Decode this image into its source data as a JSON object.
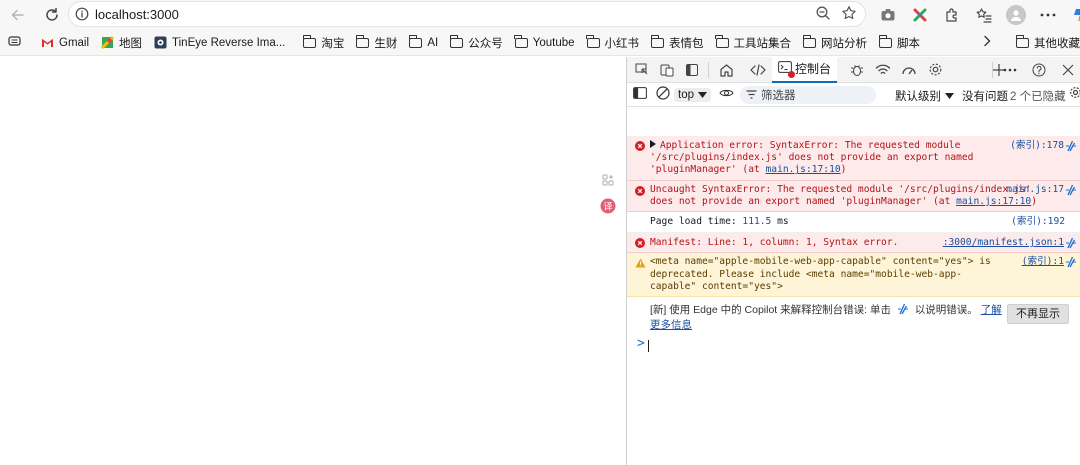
{
  "toolbar": {
    "url": "localhost:3000"
  },
  "bookmarks": {
    "items": [
      {
        "label": "Gmail",
        "icon": "gmail-icon"
      },
      {
        "label": "地图",
        "icon": "maps-icon"
      },
      {
        "label": "TinEye Reverse Ima...",
        "icon": "tineye-icon"
      },
      {
        "label": "淘宝",
        "icon": "folder-icon"
      },
      {
        "label": "生财",
        "icon": "folder-icon"
      },
      {
        "label": "AI",
        "icon": "folder-icon"
      },
      {
        "label": "公众号",
        "icon": "folder-icon"
      },
      {
        "label": "Youtube",
        "icon": "folder-icon"
      },
      {
        "label": "小红书",
        "icon": "folder-icon"
      },
      {
        "label": "表情包",
        "icon": "folder-icon"
      },
      {
        "label": "工具站集合",
        "icon": "folder-icon"
      },
      {
        "label": "网站分析",
        "icon": "folder-icon"
      },
      {
        "label": "脚本",
        "icon": "folder-icon"
      }
    ],
    "other": "其他收藏夹"
  },
  "devtools": {
    "active_tab": "控制台",
    "context": "top",
    "filter_placeholder": "筛选器",
    "levels": "默认级别",
    "issues": "没有问题",
    "hidden": "2 个已隐藏"
  },
  "console": {
    "messages": [
      {
        "level": "error",
        "text": "Application error: SyntaxError: The requested module '/src/plugins/index.js' does not provide an export named 'pluginManager' (at ",
        "link": "main.js:17:10",
        "tail": ")",
        "source": "(索引):178"
      },
      {
        "level": "error",
        "text": "Uncaught SyntaxError: The requested module '/src/plugins/index.js' does not provide an export named 'pluginManager' (at ",
        "link": "main.js:17:10",
        "tail": ")",
        "source": "main.js:17"
      },
      {
        "level": "info",
        "text": "Page load time: ",
        "value": "111.5",
        "unit": " ms",
        "source": "(索引):192"
      },
      {
        "level": "error",
        "text": "Manifest: Line: 1, column: 1, Syntax error.",
        "source": ":3000/manifest.json:1"
      },
      {
        "level": "warn",
        "text": "<meta name=\"apple-mobile-web-app-capable\" content=\"yes\"> is deprecated. Please include <meta name=\"mobile-web-app-capable\" content=\"yes\">",
        "source": "(索引):1"
      }
    ],
    "tip": {
      "text_before": "[新] 使用 Edge 中的 Copilot 来解释控制台错误: 单击",
      "text_after": "以说明错误。",
      "link": "了解更多信息",
      "button": "不再显示"
    },
    "prompt": ">"
  },
  "colors": {
    "error_bg": "#fdeaea",
    "error_text": "#b3141a",
    "warn_bg": "#fef5d8",
    "link": "#1a4fa0",
    "accent": "#0f6cbd"
  }
}
